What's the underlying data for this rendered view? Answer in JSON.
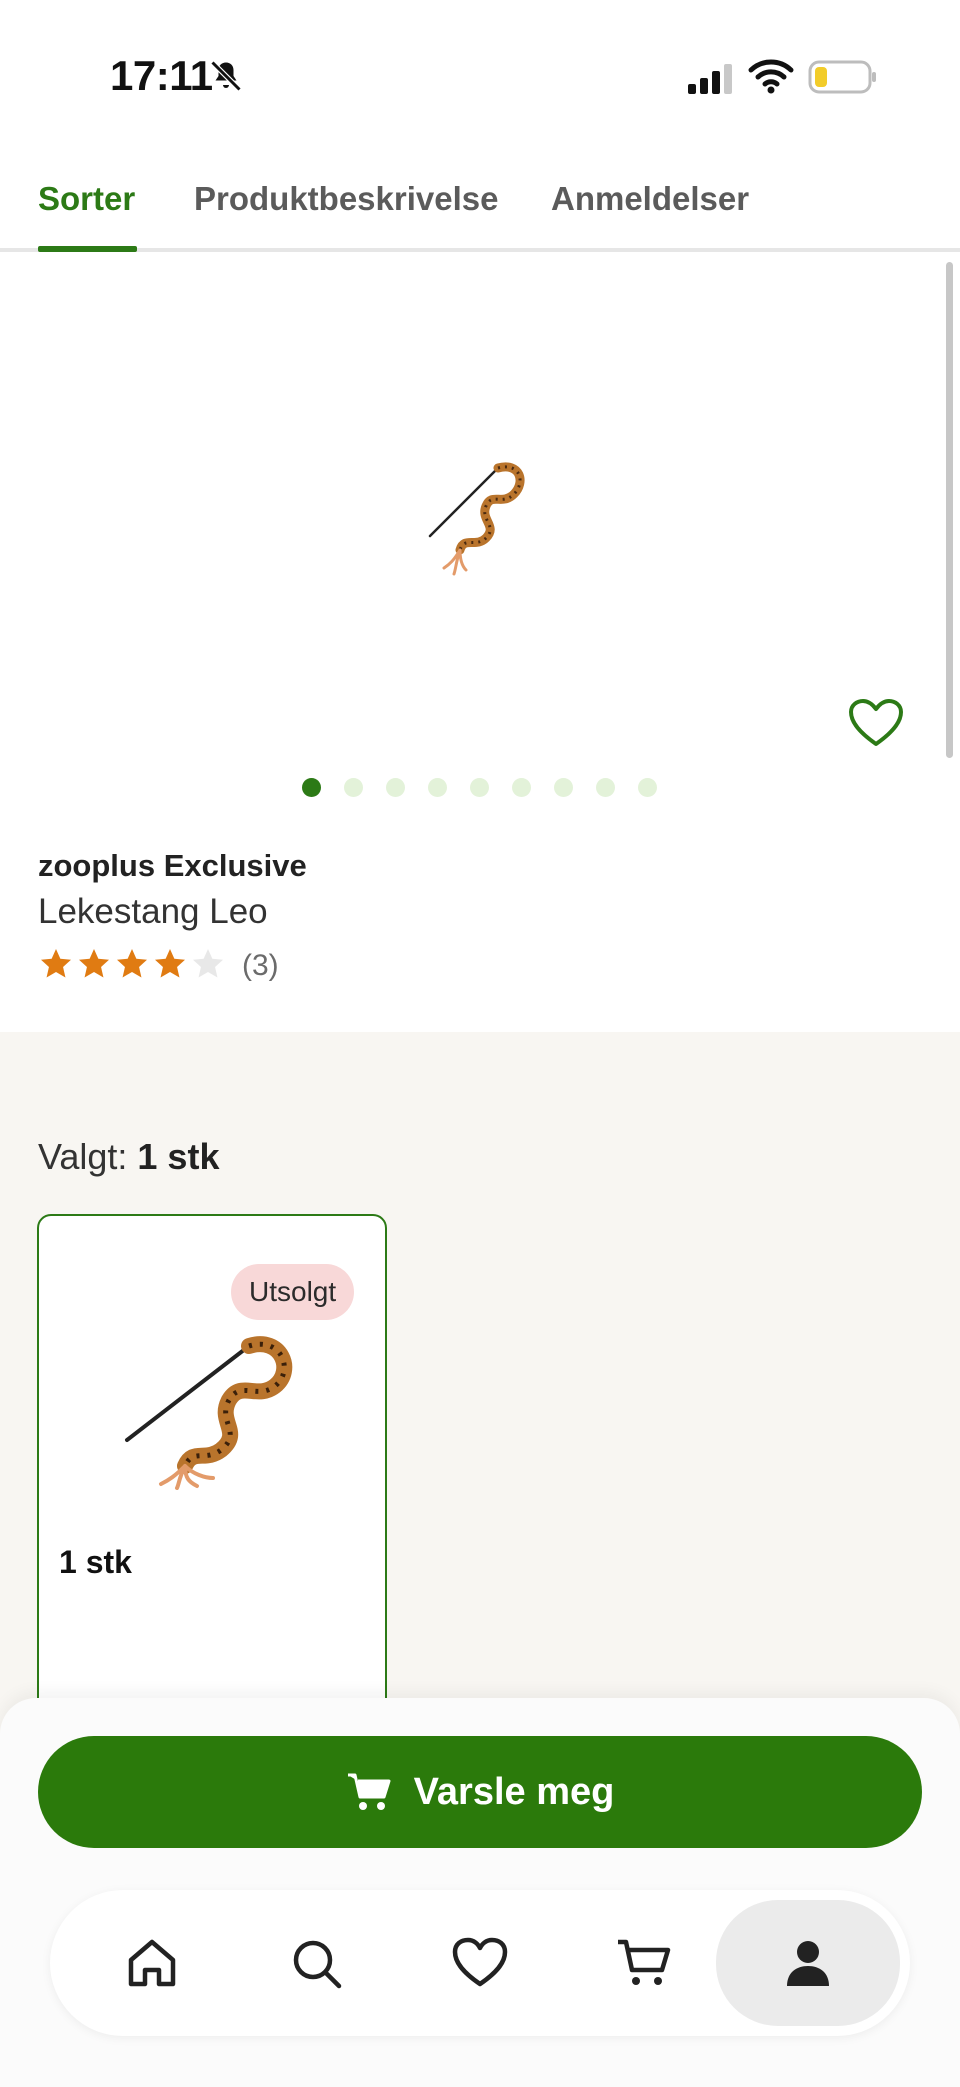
{
  "status_bar": {
    "time": "17:11",
    "icons": [
      "bell-slash-icon",
      "signal-icon",
      "wifi-icon",
      "battery-low-icon"
    ]
  },
  "tabs": [
    {
      "label": "Sorter",
      "active": true
    },
    {
      "label": "Produktbeskrivelse",
      "active": false
    },
    {
      "label": "Anmeldelser",
      "active": false
    }
  ],
  "product": {
    "brand": "zooplus Exclusive",
    "name": "Lekestang Leo",
    "rating": 4,
    "rating_max": 5,
    "review_count": "(3)",
    "image_count": 9,
    "active_image_index": 0
  },
  "selection": {
    "label_prefix": "Valgt:",
    "label_value": "1 stk",
    "variants": [
      {
        "label": "1 stk",
        "badge": "Utsolgt",
        "selected": true
      }
    ]
  },
  "actions": {
    "notify_label": "Varsle meg"
  },
  "nav": {
    "items": [
      "home-icon",
      "search-icon",
      "heart-icon",
      "cart-icon",
      "profile-icon"
    ],
    "active": "profile-icon"
  },
  "colors": {
    "accent": "#2c7a16",
    "star": "#e07b12",
    "star_empty": "#e8e8e8",
    "badge_bg": "#f8d8d8",
    "selection_bg": "#f8f6f2"
  }
}
